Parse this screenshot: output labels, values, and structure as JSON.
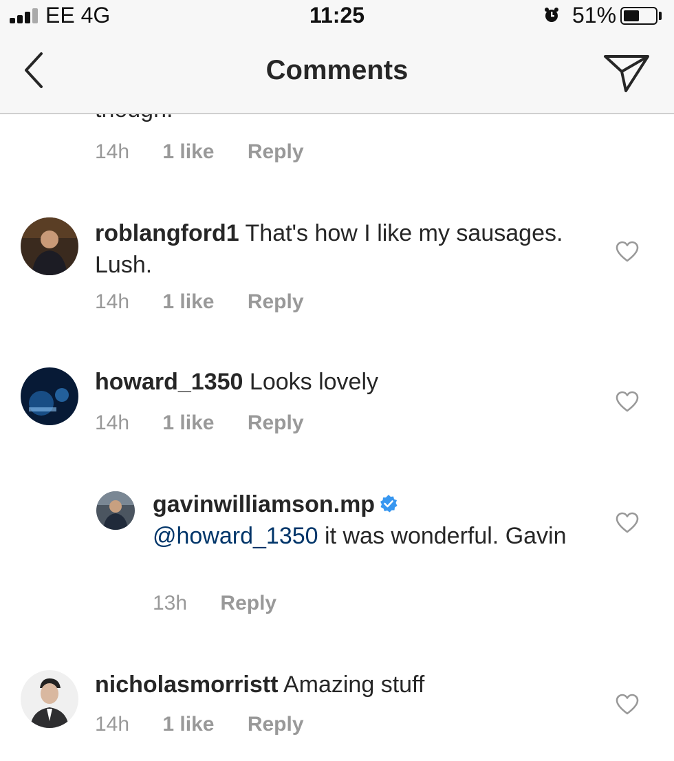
{
  "status_bar": {
    "carrier": "EE  4G",
    "time": "11:25",
    "battery_percent": "51%",
    "battery_level": 0.51
  },
  "nav": {
    "title": "Comments"
  },
  "partial_comment": {
    "text": "though.",
    "time": "14h",
    "likes": "1 like",
    "reply": "Reply"
  },
  "comments": [
    {
      "username": "roblangford1",
      "text": "That's how I like my sausages. Lush.",
      "time": "14h",
      "likes": "1 like",
      "reply": "Reply"
    },
    {
      "username": "howard_1350",
      "text": "Looks lovely",
      "time": "14h",
      "likes": "1 like",
      "reply": "Reply"
    },
    {
      "username": "gavinwilliamson.mp",
      "mention": "@howard_1350",
      "text": "it was wonderful. Gavin",
      "time": "13h",
      "reply": "Reply"
    },
    {
      "username": "nicholasmorristt",
      "text": "Amazing stuff",
      "time": "14h",
      "likes": "1 like",
      "reply": "Reply"
    }
  ],
  "colors": {
    "mention": "#003569",
    "meta": "#999999",
    "verified": "#3897f0"
  }
}
